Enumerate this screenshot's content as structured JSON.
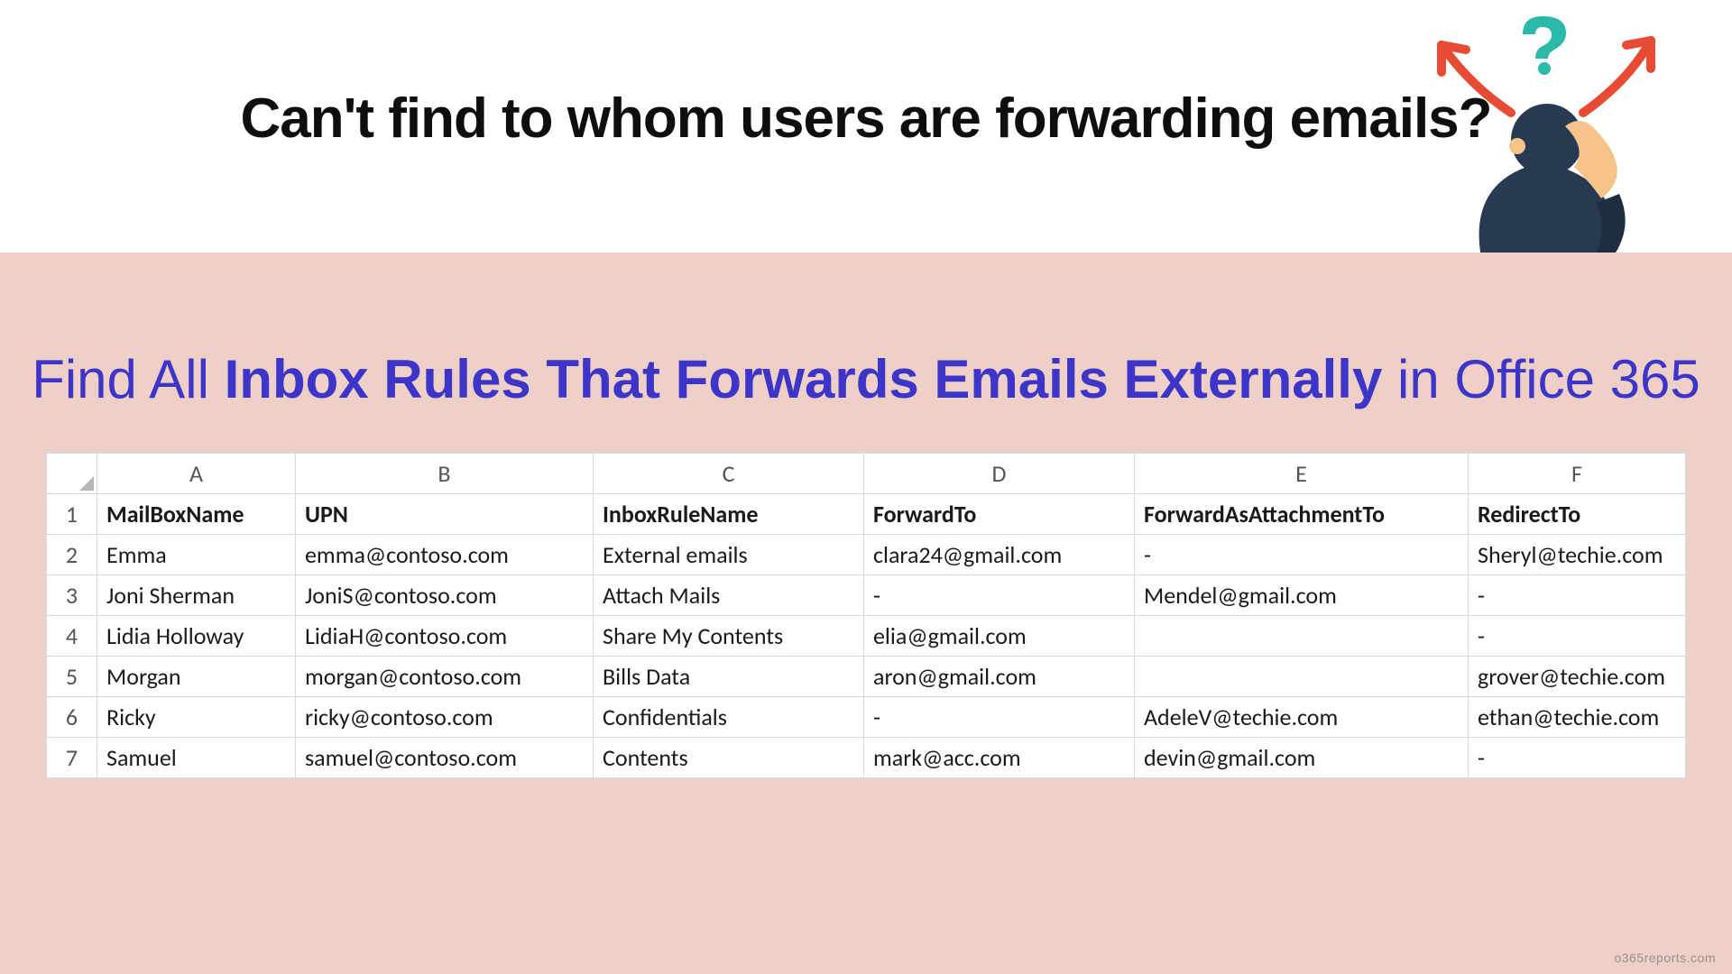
{
  "headline": "Can't find to whom users are forwarding emails?",
  "subhead_parts": {
    "a": "Find All ",
    "b": "Inbox Rules That Forwards Emails Externally",
    "c": " in Office 365"
  },
  "attribution": "o365reports.com",
  "sheet": {
    "columns": [
      "A",
      "B",
      "C",
      "D",
      "E",
      "F"
    ],
    "header": [
      "MailBoxName",
      "UPN",
      "InboxRuleName",
      "ForwardTo",
      "ForwardAsAttachmentTo",
      "RedirectTo"
    ],
    "rows": [
      [
        "Emma",
        "emma@contoso.com",
        "External emails",
        "clara24@gmail.com",
        "-",
        "Sheryl@techie.com"
      ],
      [
        "Joni Sherman",
        "JoniS@contoso.com",
        "Attach Mails",
        "-",
        "Mendel@gmail.com",
        "-"
      ],
      [
        "Lidia Holloway",
        "LidiaH@contoso.com",
        "Share My Contents",
        "elia@gmail.com",
        "",
        "-"
      ],
      [
        "Morgan",
        "morgan@contoso.com",
        "Bills Data",
        "aron@gmail.com",
        "",
        "grover@techie.com"
      ],
      [
        "Ricky",
        "ricky@contoso.com",
        "Confidentials",
        "-",
        "AdeleV@techie.com",
        "ethan@techie.com"
      ],
      [
        "Samuel",
        "samuel@contoso.com",
        "Contents",
        "mark@acc.com",
        "devin@gmail.com",
        "-"
      ]
    ],
    "row_numbers": [
      "1",
      "2",
      "3",
      "4",
      "5",
      "6",
      "7"
    ]
  }
}
